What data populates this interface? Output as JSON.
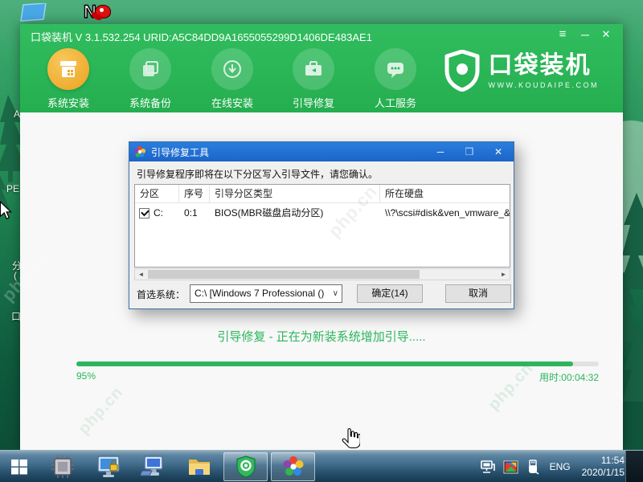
{
  "desktop": {
    "watermark_text": "php.cn",
    "partial_icon_labels": [
      "A",
      "PE",
      "分",
      "(",
      "口"
    ]
  },
  "app": {
    "window_title": "口袋装机 V 3.1.532.254 URID:A5C84DD9A1655055299D1406DE483AE1",
    "window_controls": {
      "menu": "≡",
      "minimize": "─",
      "close": "✕"
    },
    "nav_items": [
      {
        "label": "系统安装",
        "icon": "system-install-icon",
        "active": true
      },
      {
        "label": "系统备份",
        "icon": "system-backup-icon",
        "active": false
      },
      {
        "label": "在线安装",
        "icon": "online-install-icon",
        "active": false
      },
      {
        "label": "引导修复",
        "icon": "boot-repair-icon",
        "active": false
      },
      {
        "label": "人工服务",
        "icon": "human-service-icon",
        "active": false
      }
    ],
    "logo": {
      "brand": "口袋装机",
      "website": "WWW.KOUDAIPE.COM"
    },
    "status_text": "引导修复 - 正在为新装系统增加引导.....",
    "progress": {
      "percent_label": "95%",
      "value": 95,
      "elapsed_label": "用时:00:04:32"
    }
  },
  "dialog": {
    "title": "引导修复工具",
    "controls": {
      "minimize": "─",
      "maximize": "❒",
      "close": "✕"
    },
    "message": "引导修复程序即将在以下分区写入引导文件，请您确认。",
    "table": {
      "headers": [
        "分区",
        "序号",
        "引导分区类型",
        "所在硬盘"
      ],
      "row": {
        "checked": true,
        "partition": "C:",
        "order": "0:1",
        "boot_type": "BIOS(MBR磁盘启动分区)",
        "disk": "\\\\?\\scsi#disk&ven_vmware_&"
      }
    },
    "scrollbar": {
      "left_arrow": "◄",
      "right_arrow": "►"
    },
    "footer": {
      "preferred_system_label": "首选系统：",
      "combobox_value": "C:\\ [Windows 7 Professional ()",
      "combobox_arrow": "∨",
      "ok_button": "确定(14)",
      "cancel_button": "取消"
    }
  },
  "taskbar": {
    "language": "ENG",
    "time": "11:54",
    "date": "2020/1/15"
  },
  "colors": {
    "header_green": "#2ab957",
    "active_icon_orange": "#efab2f",
    "progress_green": "#2fb55f",
    "status_green": "#2db55d",
    "dialog_titlebar_blue": "#1e6fd0"
  }
}
